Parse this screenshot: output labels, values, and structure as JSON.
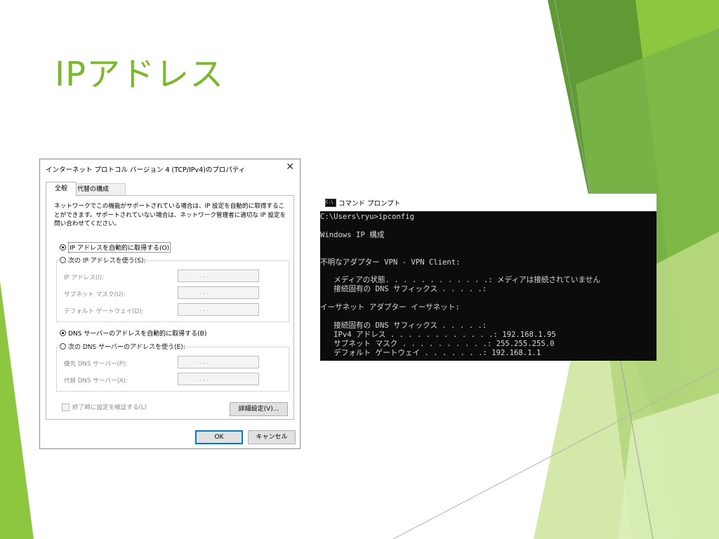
{
  "slide": {
    "title": "IPアドレス",
    "accent_color": "#7cb82f"
  },
  "dialog": {
    "title": "インターネット プロトコル バージョン 4 (TCP/IPv4)のプロパティ",
    "close_icon": "close-icon",
    "tabs": [
      {
        "label": "全般"
      },
      {
        "label": "代替の構成"
      }
    ],
    "description": "ネットワークでこの機能がサポートされている場合は、IP 設定を自動的に取得することができます。サポートされていない場合は、ネットワーク管理者に適切な IP 設定を問い合わせてください。",
    "ip_auto_label": "IP アドレスを自動的に取得する(O)",
    "ip_manual_label": "次の IP アドレスを使う(S):",
    "ip_fields": [
      {
        "label": "IP アドレス(I):",
        "value": ".       .       ."
      },
      {
        "label": "サブネット マスク(U):",
        "value": ".       .       ."
      },
      {
        "label": "デフォルト ゲートウェイ(D):",
        "value": ".       .       ."
      }
    ],
    "dns_auto_label": "DNS サーバーのアドレスを自動的に取得する(B)",
    "dns_manual_label": "次の DNS サーバーのアドレスを使う(E):",
    "dns_fields": [
      {
        "label": "優先 DNS サーバー(P):",
        "value": ".       .       ."
      },
      {
        "label": "代替 DNS サーバー(A):",
        "value": ".       .       ."
      }
    ],
    "validate_label": "終了時に設定を検証する(L)",
    "advanced_label": "詳細設定(V)...",
    "ok_label": "OK",
    "cancel_label": "キャンセル"
  },
  "console": {
    "title": "コマンド プロンプト",
    "icon_text": "C:\\",
    "lines": [
      "C:\\Users\\ryu>ipconfig",
      "",
      "Windows IP 構成",
      "",
      "",
      "不明なアダプター VPN - VPN Client:",
      "",
      "   メディアの状態. . . . . . . . . . . .: メディアは接続されていません",
      "   接続固有の DNS サフィックス . . . . .:",
      "",
      "イーサネット アダプター イーサネット:",
      "",
      "   接続固有の DNS サフィックス . . . . .:",
      "   IPv4 アドレス . . . . . . . . . . . .: 192.168.1.95",
      "   サブネット マスク . . . . . . . . . .: 255.255.255.0",
      "   デフォルト ゲートウェイ . . . . . . .: 192.168.1.1"
    ]
  }
}
